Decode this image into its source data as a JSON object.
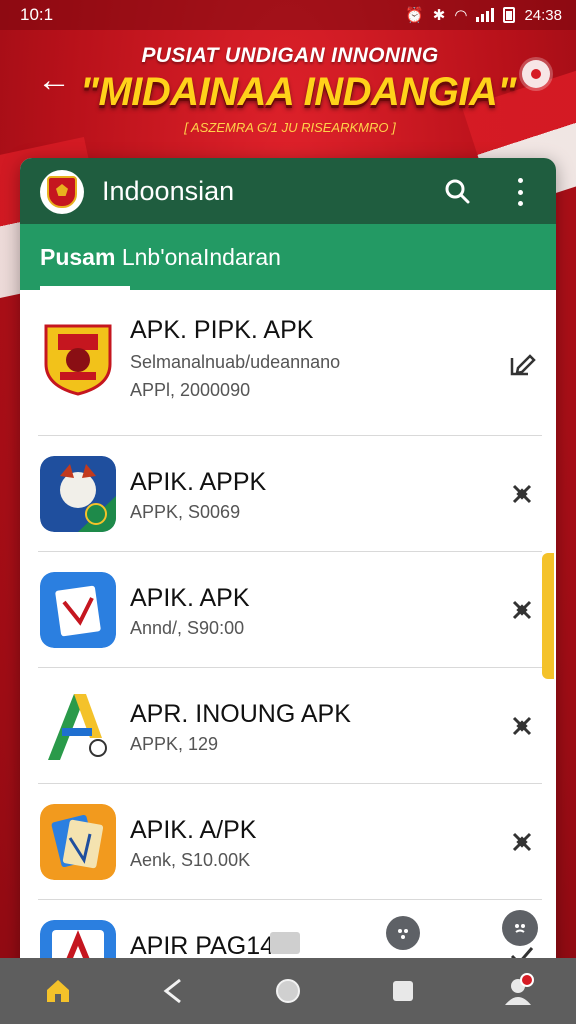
{
  "status_bar": {
    "time": "10:1",
    "clock_right": "24:38",
    "icons": [
      "alarm-icon",
      "bluetooth-icon",
      "wifi-icon",
      "signal-icon",
      "battery-icon"
    ]
  },
  "header": {
    "title_line1": "PUSIAT UNDIGAN INNONING",
    "title_line2": "\"MIDAINAA INDANGIA\"",
    "subtitle": "[ ASZEMRA G/1 JU RISEARKMRO ]"
  },
  "appbar": {
    "title": "Indoonsian"
  },
  "tabs": {
    "active_bold": "Pusam",
    "active_rest": " Lnb'onaIndaran"
  },
  "apps": [
    {
      "name": "APK. PIPK. APK",
      "line2": "Selmanalnuab/udeannano",
      "line3": "APPl, 2000090",
      "action": "edit-icon"
    },
    {
      "name": "APIK. APPK",
      "line2": "APPK, S0069",
      "line3": "",
      "action": "pin-off-icon"
    },
    {
      "name": "APIK. APK",
      "line2": "Annd/, S90:00",
      "line3": "",
      "action": "pin-off-icon"
    },
    {
      "name": "APR. INOUNG APK",
      "line2": "APPK, 129",
      "line3": "",
      "action": "pin-off-icon"
    },
    {
      "name": "APIK. A/PK",
      "line2": "Aenk, S10.00K",
      "line3": "",
      "action": "pin-off-icon"
    },
    {
      "name": "APIR PAG14",
      "line2": "",
      "line3": "",
      "action": "check-icon"
    }
  ],
  "nav": [
    "home-icon",
    "back-icon",
    "circle-home-icon",
    "recents-icon",
    "profile-icon"
  ]
}
